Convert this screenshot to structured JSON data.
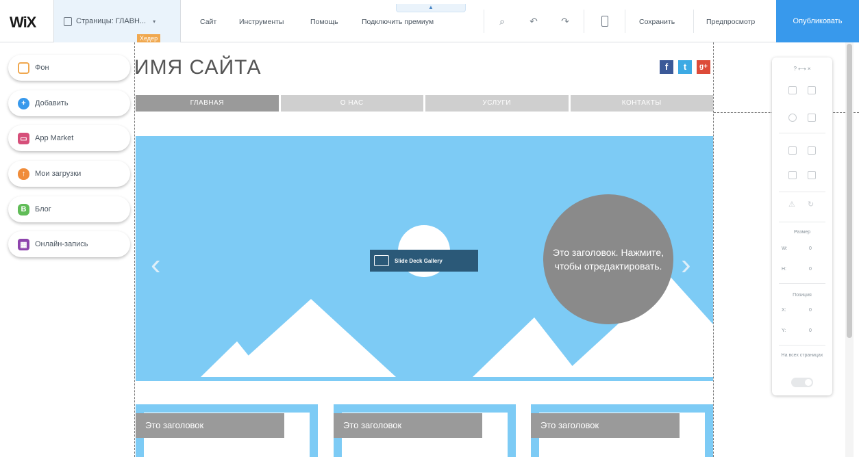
{
  "topbar": {
    "logo": "WiX",
    "pages_label": "Страницы: ГЛАВН...",
    "menu": [
      "Сайт",
      "Инструменты",
      "Помощь",
      "Подключить премиум"
    ],
    "save_label": "Сохранить",
    "preview_label": "Предпросмотр",
    "publish_label": "Опубликовать"
  },
  "left_panel": {
    "items": [
      {
        "label": "Фон",
        "icon": "background-icon",
        "color": "#f0a84f"
      },
      {
        "label": "Добавить",
        "icon": "add-icon",
        "color": "#3899ec"
      },
      {
        "label": "App Market",
        "icon": "app-market-icon",
        "color": "#d64f7a"
      },
      {
        "label": "Мои загрузки",
        "icon": "uploads-icon",
        "color": "#f08c3a"
      },
      {
        "label": "Блог",
        "icon": "blog-icon",
        "color": "#60bc57"
      },
      {
        "label": "Онлайн-запись",
        "icon": "booking-icon",
        "color": "#8e44ad"
      }
    ]
  },
  "canvas": {
    "header_tag": "Хедер",
    "site_title": "ИМЯ САЙТА",
    "social": [
      {
        "icon": "facebook-icon",
        "glyph": "f",
        "color": "#3b5998"
      },
      {
        "icon": "twitter-icon",
        "glyph": "t",
        "color": "#3daae4"
      },
      {
        "icon": "googleplus-icon",
        "glyph": "g+",
        "color": "#dd4b39"
      }
    ],
    "nav": [
      "ГЛАВНАЯ",
      "О НАС",
      "УСЛУГИ",
      "КОНТАКТЫ"
    ],
    "slider": {
      "caption": "Это заголовок. Нажмите, чтобы отредактировать.",
      "gallery_tag": "Slide Deck Gallery"
    },
    "cards": [
      "Это заголовок",
      "Это заголовок",
      "Это заголовок"
    ]
  },
  "right_panel": {
    "header": "?   ⟷   ×",
    "size_label": "Размер",
    "w_label": "W:",
    "h_label": "H:",
    "position_label": "Позиция",
    "x_label": "X:",
    "y_label": "Y:",
    "all_pages_label": "На всех страницах"
  }
}
